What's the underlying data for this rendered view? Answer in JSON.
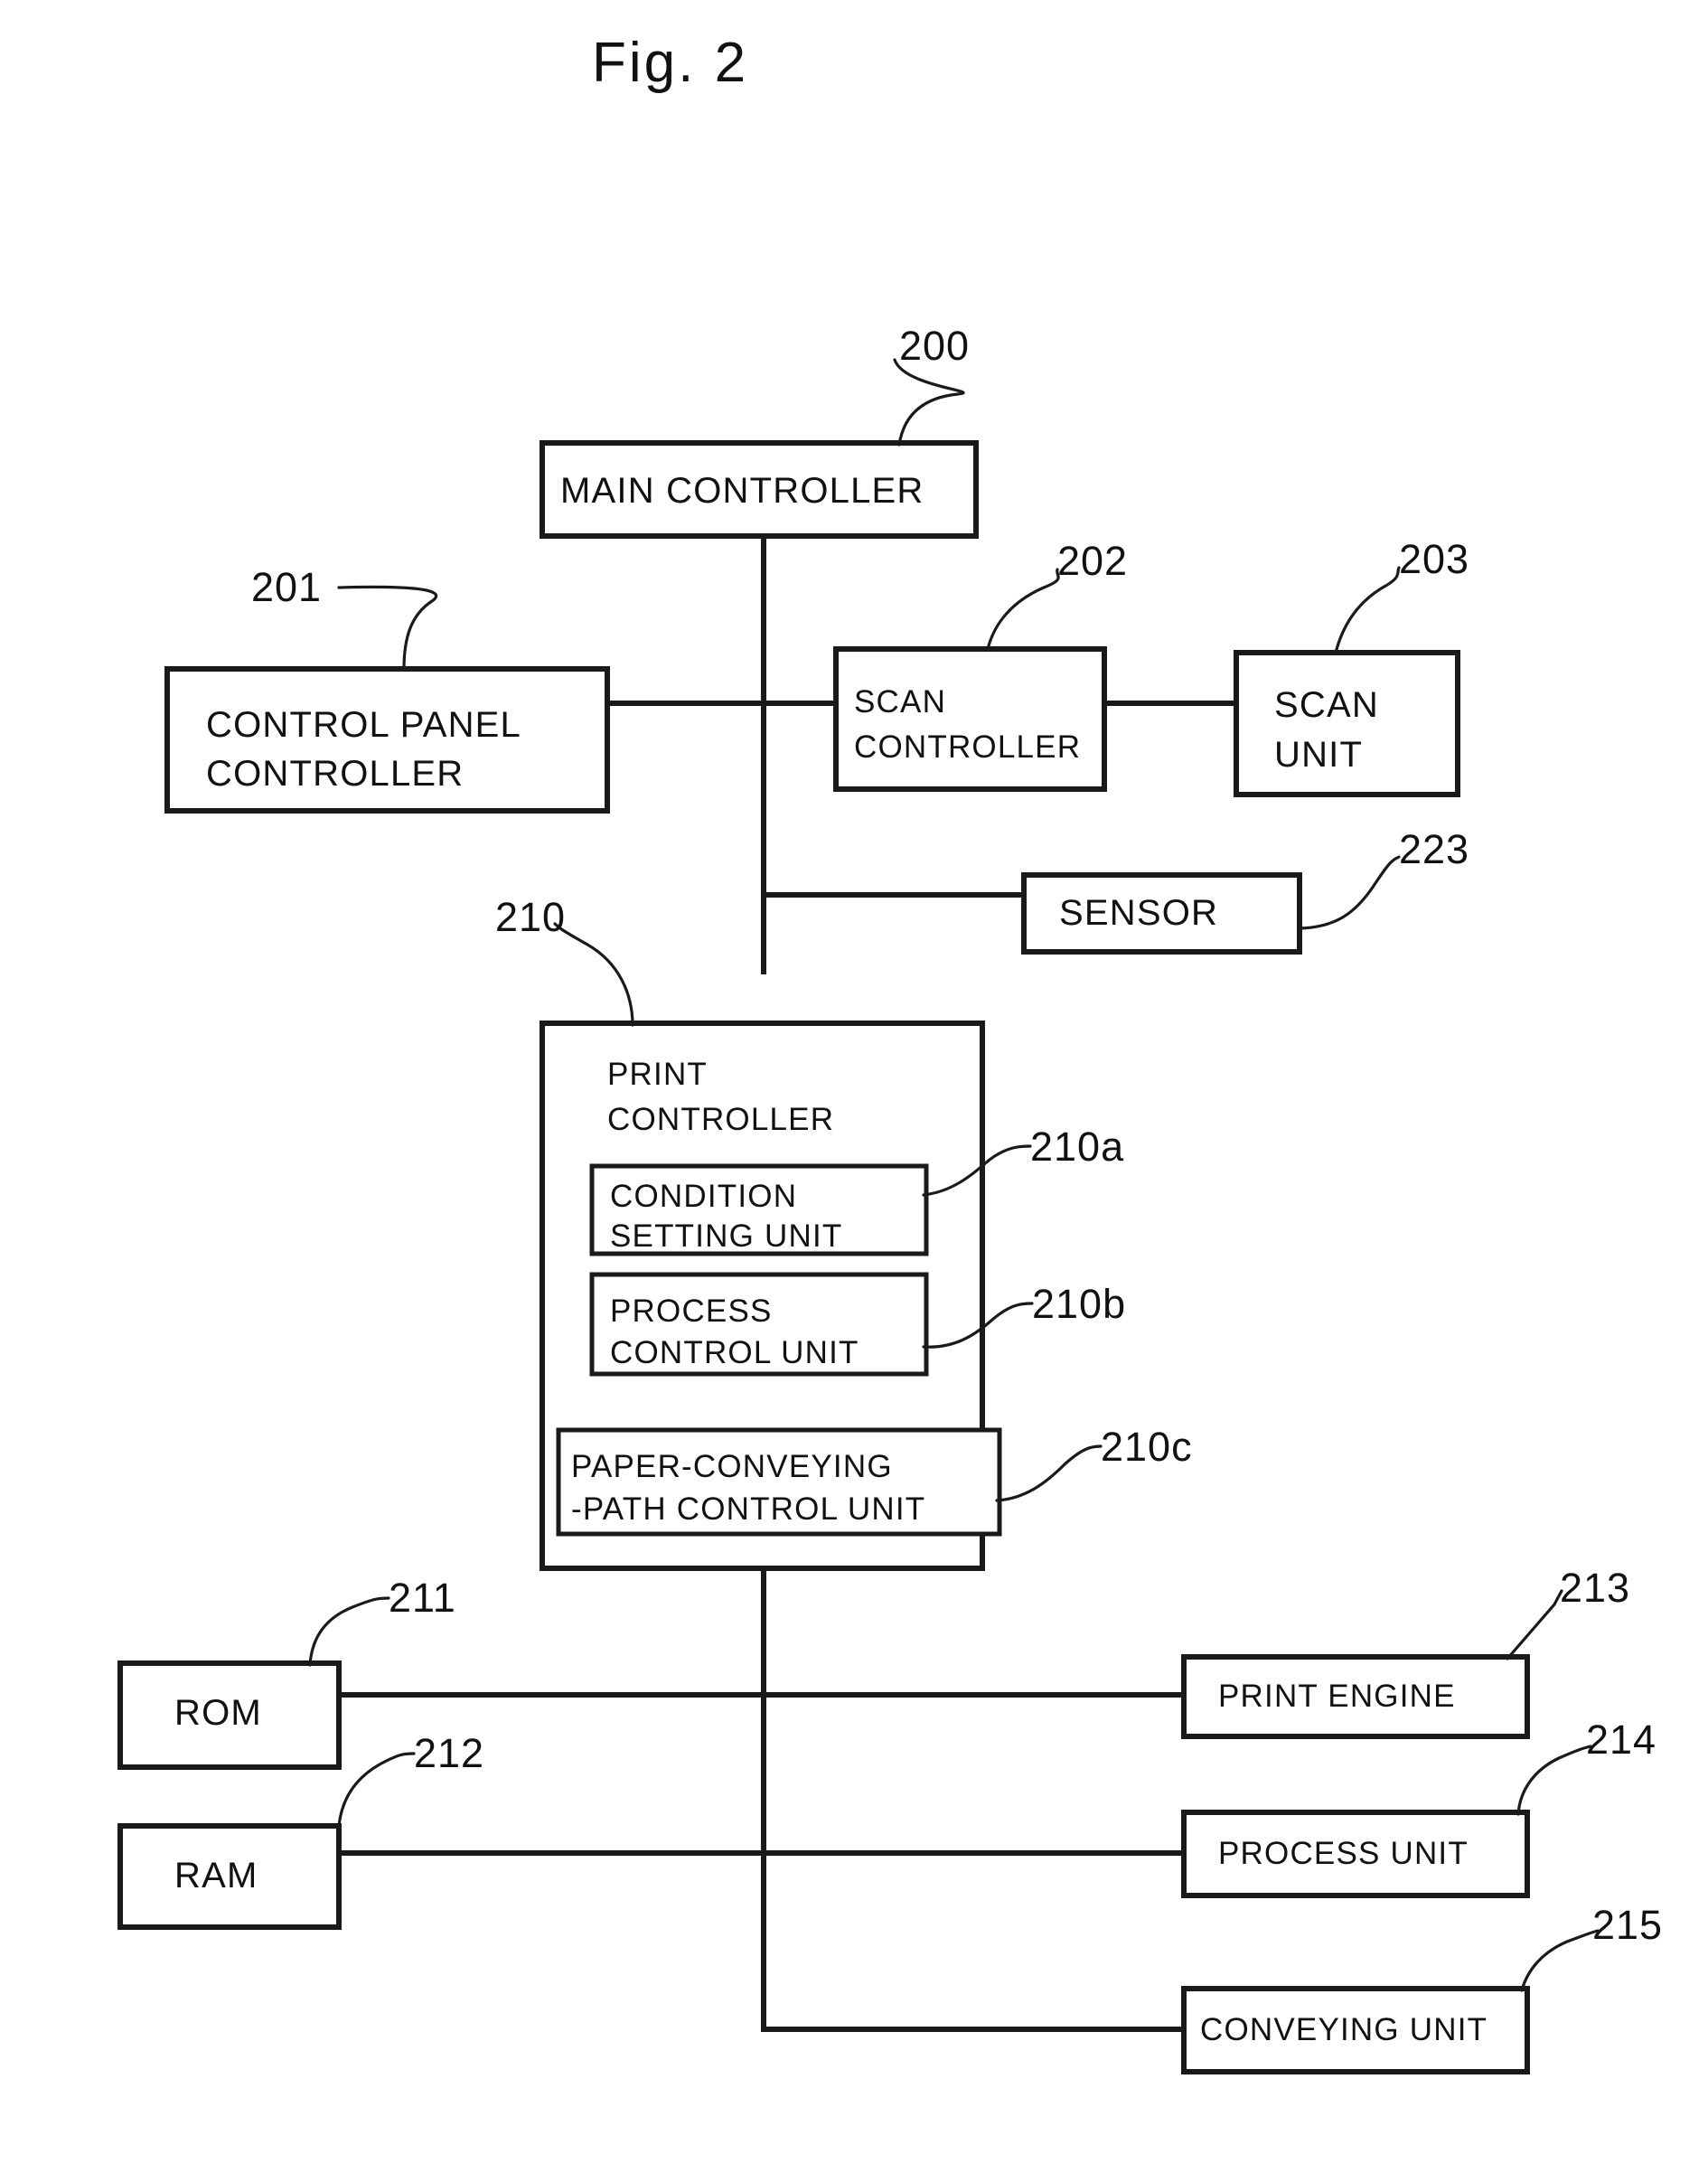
{
  "figure": {
    "title": "Fig. 2",
    "type": "patent-block-diagram"
  },
  "blocks": {
    "main_controller": {
      "label": "MAIN CONTROLLER",
      "ref": "200"
    },
    "control_panel_controller": {
      "label_line1": "CONTROL PANEL",
      "label_line2": "CONTROLLER",
      "ref": "201"
    },
    "scan_controller": {
      "label_line1": "SCAN",
      "label_line2": "CONTROLLER",
      "ref": "202"
    },
    "scan_unit": {
      "label_line1": "SCAN",
      "label_line2": "UNIT",
      "ref": "203"
    },
    "sensor": {
      "label": "SENSOR",
      "ref": "223"
    },
    "print_controller": {
      "label_line1": "PRINT",
      "label_line2": "CONTROLLER",
      "ref": "210"
    },
    "condition_setting_unit": {
      "label_line1": "CONDITION",
      "label_line2": "SETTING UNIT",
      "ref": "210a"
    },
    "process_control_unit": {
      "label_line1": "PROCESS",
      "label_line2": "CONTROL UNIT",
      "ref": "210b"
    },
    "paper_conveying_path_control_unit": {
      "label_line1": "PAPER-CONVEYING",
      "label_line2": "-PATH CONTROL UNIT",
      "ref": "210c"
    },
    "rom": {
      "label": "ROM",
      "ref": "211"
    },
    "ram": {
      "label": "RAM",
      "ref": "212"
    },
    "print_engine": {
      "label": "PRINT ENGINE",
      "ref": "213"
    },
    "process_unit": {
      "label": "PROCESS UNIT",
      "ref": "214"
    },
    "conveying_unit": {
      "label": "CONVEYING UNIT",
      "ref": "215"
    }
  },
  "colors": {
    "ink": "#1a1a1a",
    "paper": "#ffffff"
  }
}
